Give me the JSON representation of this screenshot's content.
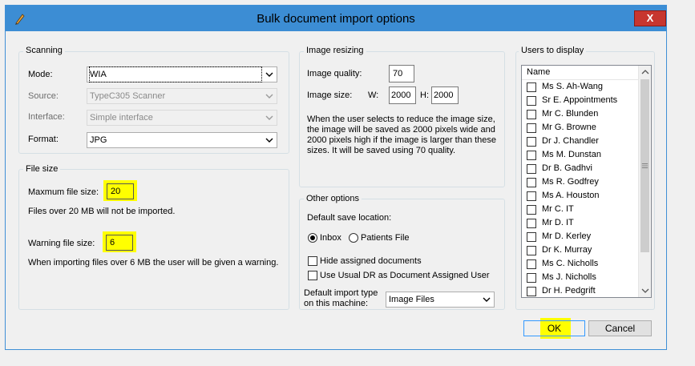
{
  "window": {
    "title": "Bulk document import options",
    "close_glyph": "X"
  },
  "scanning": {
    "group_label": "Scanning",
    "mode_label": "Mode:",
    "mode_value": "WIA",
    "source_label": "Source:",
    "source_value": "TypeC305 Scanner",
    "interface_label": "Interface:",
    "interface_value": "Simple interface",
    "format_label": "Format:",
    "format_value": "JPG"
  },
  "file_size": {
    "group_label": "File size",
    "max_label": "Maxmum file size:",
    "max_value": "20",
    "max_note": "Files over 20 MB will not be imported.",
    "warn_label": "Warning file size:",
    "warn_value": "6",
    "warn_note": "When importing files over 6 MB the user will be given a warning."
  },
  "image_resizing": {
    "group_label": "Image resizing",
    "quality_label": "Image quality:",
    "quality_value": "70",
    "size_label": "Image size:",
    "w_label": "W:",
    "w_value": "2000",
    "h_label": "H:",
    "h_value": "2000",
    "note_line1": "When the user selects to reduce the image size,",
    "note_line2": "the image will be saved as 2000 pixels wide and",
    "note_line3": "2000 pixels high if the image is larger than these",
    "note_line4": "sizes. It will be saved using 70 quality."
  },
  "other_options": {
    "group_label": "Other options",
    "save_location_label": "Default save location:",
    "inbox_label": "Inbox",
    "inbox_selected": true,
    "patients_file_label": "Patients File",
    "hide_assigned_label": "Hide assigned documents",
    "hide_assigned_checked": false,
    "use_usual_dr_label": "Use Usual DR as Document Assigned User",
    "use_usual_dr_checked": false,
    "import_type_label_line1": "Default import type",
    "import_type_label_line2": "on this machine:",
    "import_type_value": "Image Files"
  },
  "users": {
    "group_label": "Users to display",
    "column_header": "Name",
    "items": [
      "Ms S. Ah-Wang",
      "Sr E. Appointments",
      "Mr C. Blunden",
      "Mr G. Browne",
      "Dr J. Chandler",
      "Ms M. Dunstan",
      "Dr B. Gadhvi",
      "Ms R. Godfrey",
      "Ms A. Houston",
      "Mr C. IT",
      "Mr D. IT",
      "Mr D. Kerley",
      "Dr K. Murray",
      "Ms C. Nicholls",
      "Ms J. Nicholls",
      "Dr H. Pedgrift"
    ]
  },
  "buttons": {
    "ok_label": "OK",
    "cancel_label": "Cancel"
  },
  "colors": {
    "titlebar": "#3c8dd4",
    "close_button": "#c7362f",
    "highlight": "#ffff00"
  }
}
